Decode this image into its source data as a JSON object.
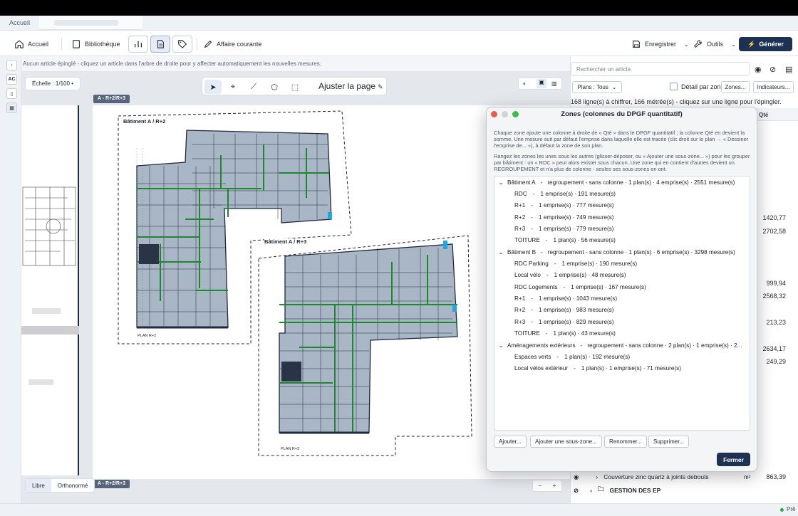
{
  "tabs": {
    "home": "Accueil"
  },
  "toolbar": {
    "home": "Accueil",
    "library": "Bibliothèque",
    "current_affair": "Affaire courante",
    "save": "Enregistrer",
    "tools": "Outils",
    "generate": "Générer"
  },
  "left_rail": {
    "ac": "AC"
  },
  "hint": "Aucun article épinglé - cliquez un article dans l'arbre de droite pour y affecter automatiquement les nouvelles mesures.",
  "canvas": {
    "scale": "Échelle : 1/100 •",
    "fit": "Ajuster la page",
    "page_label_top": "A - R+2/R+3",
    "page_label_bottom": "A - R+2/R+3",
    "plan_a_label": "Bâtiment A / R+2",
    "plan_b_label": "Bâtiment A / R+3",
    "plan_a_caption": "PLAN R+2",
    "plan_b_caption": "PLAN R+3",
    "mode_free": "Libre",
    "mode_ortho": "Orthonormé",
    "zoom_minus": "−",
    "zoom_plus": "+"
  },
  "right": {
    "search_placeholder": "Rechercher un article.",
    "plans_filter": "Plans : Tous",
    "detail_zone": "Détail par zone",
    "zones_btn": "Zones...",
    "indicators_btn": "Indicateurs...",
    "info": "168 ligne(s) à chiffrer, 166 métrée(s) - cliquez sur une ligne pour l'épingler.",
    "qty_header": "Qté",
    "quantities": [
      "1420,77",
      "2702,58",
      "999,94",
      "2568,32",
      "213,23",
      "2634,17",
      "249,29"
    ],
    "row_zinc": {
      "label": "Couverture zinc quartz à joints debouts",
      "unit": "m²",
      "qty": "863,39"
    },
    "row_ep": {
      "label": "GESTION DES EP"
    },
    "status": "Prê"
  },
  "modal": {
    "title": "Zones (colonnes du DPGF quantitatif)",
    "desc1": "Chaque zone ajoute une colonne à droite de « Qté » dans le DPGF quantitatif ; la colonne Qté en devient la somme. Une mesure suit par défaut l'emprise dans laquelle elle est tracée (clic droit sur le plan → « Dessiner l'emprise de... »), à défaut la zone de son plan.",
    "desc2": "Rangez les zones les unes sous les autres (glisser-déposer, ou « Ajouter une sous-zone... ») pour les grouper par bâtiment : un « RDC » peut alors exister sous chacun. Une zone qui en contient d'autres devient un REGROUPEMENT et n'a plus de colonne - seules ses sous-zones en ont.",
    "groups": [
      {
        "name": "Bâtiment A",
        "detail": "regroupement - sans colonne · 1 plan(s) · 4 emprise(s) · 2551 mesure(s)",
        "children": [
          {
            "name": "RDC",
            "detail": "1 emprise(s) · 191 mesure(s)"
          },
          {
            "name": "R+1",
            "detail": "1 emprise(s) · 777 mesure(s)"
          },
          {
            "name": "R+2",
            "detail": "1 emprise(s) · 749 mesure(s)"
          },
          {
            "name": "R+3",
            "detail": "1 emprise(s) · 779 mesure(s)"
          },
          {
            "name": "TOITURE",
            "detail": "1 plan(s) · 56 mesure(s)"
          }
        ]
      },
      {
        "name": "Bâtiment B",
        "detail": "regroupement - sans colonne · 1 plan(s) · 6 emprise(s) · 3298 mesure(s)",
        "children": [
          {
            "name": "RDC Parking",
            "detail": "1 emprise(s) · 190 mesure(s)"
          },
          {
            "name": "Local vélo",
            "detail": "1 emprise(s) · 48 mesure(s)"
          },
          {
            "name": "RDC Logements",
            "detail": "1 emprise(s) · 167 mesure(s)"
          },
          {
            "name": "R+1",
            "detail": "1 emprise(s) · 1043 mesure(s)"
          },
          {
            "name": "R+2",
            "detail": "1 emprise(s) · 983 mesure(s)"
          },
          {
            "name": "R+3",
            "detail": "1 emprise(s) · 829 mesure(s)"
          },
          {
            "name": "TOITURE",
            "detail": "1 plan(s) · 43 mesure(s)"
          }
        ]
      },
      {
        "name": "Aménagements extérieurs",
        "detail": "regroupement - sans colonne · 2 plan(s) · 1 emprise(s) · 2...",
        "children": [
          {
            "name": "Espaces verts",
            "detail": "1 plan(s) · 192 mesure(s)"
          },
          {
            "name": "Local vélos extérieur",
            "detail": "1 plan(s) · 1 emprise(s) · 71 mesure(s)"
          }
        ]
      }
    ],
    "buttons": {
      "add": "Ajouter...",
      "add_sub": "Ajouter une sous-zone...",
      "rename": "Renommer...",
      "delete": "Supprimer...",
      "close": "Fermer"
    }
  }
}
